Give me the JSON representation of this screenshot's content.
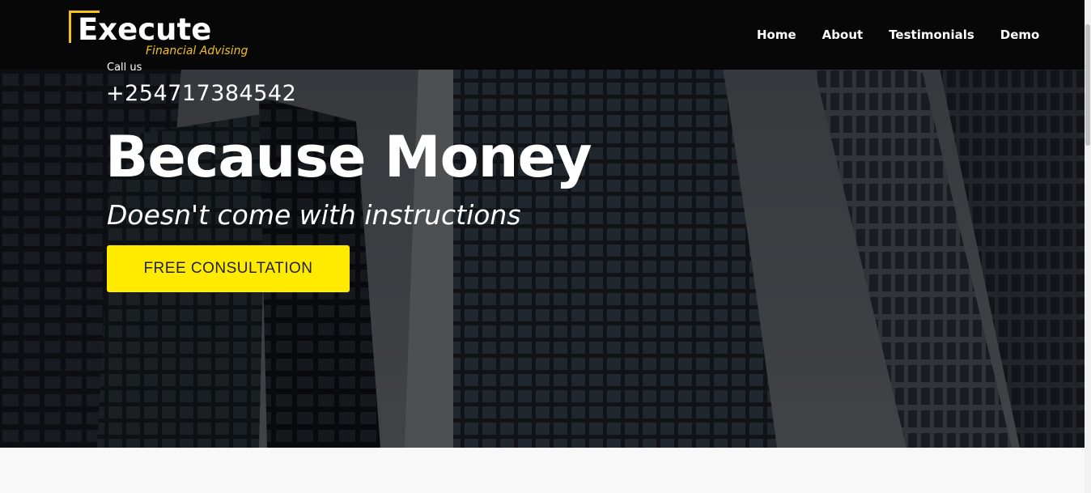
{
  "header": {
    "logo_text": "Execute",
    "logo_tagline": "Financial Advising",
    "nav": [
      {
        "label": "Home"
      },
      {
        "label": "About"
      },
      {
        "label": "Testimonials"
      },
      {
        "label": "Demo"
      }
    ]
  },
  "hero": {
    "call_label": "Call us",
    "phone": "+254717384542",
    "headline": "Because Money",
    "subheadline": "Doesn't come with instructions",
    "cta_label": "FREE CONSULTATION"
  },
  "colors": {
    "accent": "#f3c317",
    "cta": "#ffea00",
    "navbar": "#070707"
  }
}
